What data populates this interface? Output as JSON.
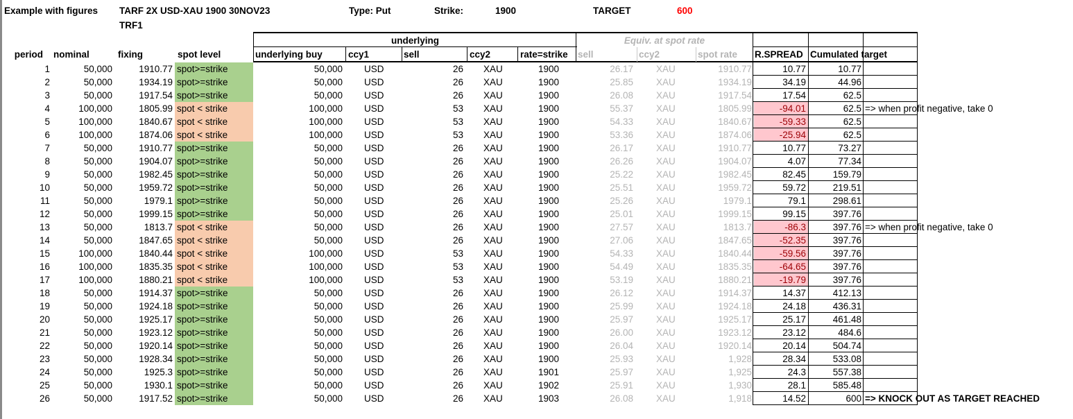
{
  "header": {
    "example_label": "Example with figures",
    "product": "TARF 2X USD-XAU 1900 30NOV23",
    "product_code": "TRF1",
    "type_label": "Type: Put",
    "strike_label": "Strike:",
    "strike_value": "1900",
    "target_label": "TARGET",
    "target_value": "600"
  },
  "groups": {
    "underlying": "underlying",
    "equiv": "Equiv. at spot rate"
  },
  "columns": {
    "period": "period",
    "nominal": "nominal",
    "fixing": "fixing",
    "spot_level": "spot level",
    "underlying_buy": "underlying buy",
    "ccy1": "ccy1",
    "sell": "sell",
    "ccy2": "ccy2",
    "rate_strike": "rate=strike",
    "eq_sell": "sell",
    "eq_ccy2": "ccy2",
    "spot_rate": "spot rate",
    "r_spread": "R.SPREAD",
    "cum_target": "Cumulated target"
  },
  "colors": {
    "green": "#a9d08e",
    "orange": "#f8cbad",
    "pink": "#ffc7ce",
    "dark_red": "#9c0006"
  },
  "rows": [
    {
      "period": "1",
      "nominal": "50,000",
      "fixing": "1910.77",
      "spot": "spot>=strike",
      "buy": "50,000",
      "ccy1": "USD",
      "sell": "26",
      "ccy2": "XAU",
      "rate": "1900",
      "eq_sell": "26.17",
      "eq_ccy2": "XAU",
      "spot_rate": "1910.77",
      "spread": "10.77",
      "cum": "10.77",
      "note": ""
    },
    {
      "period": "2",
      "nominal": "50,000",
      "fixing": "1934.19",
      "spot": "spot>=strike",
      "buy": "50,000",
      "ccy1": "USD",
      "sell": "26",
      "ccy2": "XAU",
      "rate": "1900",
      "eq_sell": "25.85",
      "eq_ccy2": "XAU",
      "spot_rate": "1934.19",
      "spread": "34.19",
      "cum": "44.96",
      "note": ""
    },
    {
      "period": "3",
      "nominal": "50,000",
      "fixing": "1917.54",
      "spot": "spot>=strike",
      "buy": "50,000",
      "ccy1": "USD",
      "sell": "26",
      "ccy2": "XAU",
      "rate": "1900",
      "eq_sell": "26.08",
      "eq_ccy2": "XAU",
      "spot_rate": "1917.54",
      "spread": "17.54",
      "cum": "62.5",
      "note": ""
    },
    {
      "period": "4",
      "nominal": "100,000",
      "fixing": "1805.99",
      "spot": "spot < strike",
      "buy": "100,000",
      "ccy1": "USD",
      "sell": "53",
      "ccy2": "XAU",
      "rate": "1900",
      "eq_sell": "55.37",
      "eq_ccy2": "XAU",
      "spot_rate": "1805.99",
      "spread": "-94.01",
      "cum": "62.5",
      "note": "=> when profit negative, take 0"
    },
    {
      "period": "5",
      "nominal": "100,000",
      "fixing": "1840.67",
      "spot": "spot < strike",
      "buy": "100,000",
      "ccy1": "USD",
      "sell": "53",
      "ccy2": "XAU",
      "rate": "1900",
      "eq_sell": "54.33",
      "eq_ccy2": "XAU",
      "spot_rate": "1840.67",
      "spread": "-59.33",
      "cum": "62.5",
      "note": ""
    },
    {
      "period": "6",
      "nominal": "100,000",
      "fixing": "1874.06",
      "spot": "spot < strike",
      "buy": "100,000",
      "ccy1": "USD",
      "sell": "53",
      "ccy2": "XAU",
      "rate": "1900",
      "eq_sell": "53.36",
      "eq_ccy2": "XAU",
      "spot_rate": "1874.06",
      "spread": "-25.94",
      "cum": "62.5",
      "note": ""
    },
    {
      "period": "7",
      "nominal": "50,000",
      "fixing": "1910.77",
      "spot": "spot>=strike",
      "buy": "50,000",
      "ccy1": "USD",
      "sell": "26",
      "ccy2": "XAU",
      "rate": "1900",
      "eq_sell": "26.17",
      "eq_ccy2": "XAU",
      "spot_rate": "1910.77",
      "spread": "10.77",
      "cum": "73.27",
      "note": ""
    },
    {
      "period": "8",
      "nominal": "50,000",
      "fixing": "1904.07",
      "spot": "spot>=strike",
      "buy": "50,000",
      "ccy1": "USD",
      "sell": "26",
      "ccy2": "XAU",
      "rate": "1900",
      "eq_sell": "26.26",
      "eq_ccy2": "XAU",
      "spot_rate": "1904.07",
      "spread": "4.07",
      "cum": "77.34",
      "note": ""
    },
    {
      "period": "9",
      "nominal": "50,000",
      "fixing": "1982.45",
      "spot": "spot>=strike",
      "buy": "50,000",
      "ccy1": "USD",
      "sell": "26",
      "ccy2": "XAU",
      "rate": "1900",
      "eq_sell": "25.22",
      "eq_ccy2": "XAU",
      "spot_rate": "1982.45",
      "spread": "82.45",
      "cum": "159.79",
      "note": ""
    },
    {
      "period": "10",
      "nominal": "50,000",
      "fixing": "1959.72",
      "spot": "spot>=strike",
      "buy": "50,000",
      "ccy1": "USD",
      "sell": "26",
      "ccy2": "XAU",
      "rate": "1900",
      "eq_sell": "25.51",
      "eq_ccy2": "XAU",
      "spot_rate": "1959.72",
      "spread": "59.72",
      "cum": "219.51",
      "note": ""
    },
    {
      "period": "11",
      "nominal": "50,000",
      "fixing": "1979.1",
      "spot": "spot>=strike",
      "buy": "50,000",
      "ccy1": "USD",
      "sell": "26",
      "ccy2": "XAU",
      "rate": "1900",
      "eq_sell": "25.26",
      "eq_ccy2": "XAU",
      "spot_rate": "1979.1",
      "spread": "79.1",
      "cum": "298.61",
      "note": ""
    },
    {
      "period": "12",
      "nominal": "50,000",
      "fixing": "1999.15",
      "spot": "spot>=strike",
      "buy": "50,000",
      "ccy1": "USD",
      "sell": "26",
      "ccy2": "XAU",
      "rate": "1900",
      "eq_sell": "25.01",
      "eq_ccy2": "XAU",
      "spot_rate": "1999.15",
      "spread": "99.15",
      "cum": "397.76",
      "note": ""
    },
    {
      "period": "13",
      "nominal": "50,000",
      "fixing": "1813.7",
      "spot": "spot < strike",
      "buy": "50,000",
      "ccy1": "USD",
      "sell": "26",
      "ccy2": "XAU",
      "rate": "1900",
      "eq_sell": "27.57",
      "eq_ccy2": "XAU",
      "spot_rate": "1813.7",
      "spread": "-86.3",
      "cum": "397.76",
      "note": "=> when profit negative, take 0"
    },
    {
      "period": "14",
      "nominal": "50,000",
      "fixing": "1847.65",
      "spot": "spot < strike",
      "buy": "50,000",
      "ccy1": "USD",
      "sell": "26",
      "ccy2": "XAU",
      "rate": "1900",
      "eq_sell": "27.06",
      "eq_ccy2": "XAU",
      "spot_rate": "1847.65",
      "spread": "-52.35",
      "cum": "397.76",
      "note": ""
    },
    {
      "period": "15",
      "nominal": "100,000",
      "fixing": "1840.44",
      "spot": "spot < strike",
      "buy": "100,000",
      "ccy1": "USD",
      "sell": "53",
      "ccy2": "XAU",
      "rate": "1900",
      "eq_sell": "54.33",
      "eq_ccy2": "XAU",
      "spot_rate": "1840.44",
      "spread": "-59.56",
      "cum": "397.76",
      "note": ""
    },
    {
      "period": "16",
      "nominal": "100,000",
      "fixing": "1835.35",
      "spot": "spot < strike",
      "buy": "100,000",
      "ccy1": "USD",
      "sell": "53",
      "ccy2": "XAU",
      "rate": "1900",
      "eq_sell": "54.49",
      "eq_ccy2": "XAU",
      "spot_rate": "1835.35",
      "spread": "-64.65",
      "cum": "397.76",
      "note": ""
    },
    {
      "period": "17",
      "nominal": "100,000",
      "fixing": "1880.21",
      "spot": "spot < strike",
      "buy": "100,000",
      "ccy1": "USD",
      "sell": "53",
      "ccy2": "XAU",
      "rate": "1900",
      "eq_sell": "53.19",
      "eq_ccy2": "XAU",
      "spot_rate": "1880.21",
      "spread": "-19.79",
      "cum": "397.76",
      "note": ""
    },
    {
      "period": "18",
      "nominal": "50,000",
      "fixing": "1914.37",
      "spot": "spot>=strike",
      "buy": "50,000",
      "ccy1": "USD",
      "sell": "26",
      "ccy2": "XAU",
      "rate": "1900",
      "eq_sell": "26.12",
      "eq_ccy2": "XAU",
      "spot_rate": "1914.37",
      "spread": "14.37",
      "cum": "412.13",
      "note": ""
    },
    {
      "period": "19",
      "nominal": "50,000",
      "fixing": "1924.18",
      "spot": "spot>=strike",
      "buy": "50,000",
      "ccy1": "USD",
      "sell": "26",
      "ccy2": "XAU",
      "rate": "1900",
      "eq_sell": "25.99",
      "eq_ccy2": "XAU",
      "spot_rate": "1924.18",
      "spread": "24.18",
      "cum": "436.31",
      "note": ""
    },
    {
      "period": "20",
      "nominal": "50,000",
      "fixing": "1925.17",
      "spot": "spot>=strike",
      "buy": "50,000",
      "ccy1": "USD",
      "sell": "26",
      "ccy2": "XAU",
      "rate": "1900",
      "eq_sell": "25.97",
      "eq_ccy2": "XAU",
      "spot_rate": "1925.17",
      "spread": "25.17",
      "cum": "461.48",
      "note": ""
    },
    {
      "period": "21",
      "nominal": "50,000",
      "fixing": "1923.12",
      "spot": "spot>=strike",
      "buy": "50,000",
      "ccy1": "USD",
      "sell": "26",
      "ccy2": "XAU",
      "rate": "1900",
      "eq_sell": "26.00",
      "eq_ccy2": "XAU",
      "spot_rate": "1923.12",
      "spread": "23.12",
      "cum": "484.6",
      "note": ""
    },
    {
      "period": "22",
      "nominal": "50,000",
      "fixing": "1920.14",
      "spot": "spot>=strike",
      "buy": "50,000",
      "ccy1": "USD",
      "sell": "26",
      "ccy2": "XAU",
      "rate": "1900",
      "eq_sell": "26.04",
      "eq_ccy2": "XAU",
      "spot_rate": "1920.14",
      "spread": "20.14",
      "cum": "504.74",
      "note": ""
    },
    {
      "period": "23",
      "nominal": "50,000",
      "fixing": "1928.34",
      "spot": "spot>=strike",
      "buy": "50,000",
      "ccy1": "USD",
      "sell": "26",
      "ccy2": "XAU",
      "rate": "1900",
      "eq_sell": "25.93",
      "eq_ccy2": "XAU",
      "spot_rate": "1,928",
      "spread": "28.34",
      "cum": "533.08",
      "note": ""
    },
    {
      "period": "24",
      "nominal": "50,000",
      "fixing": "1925.3",
      "spot": "spot>=strike",
      "buy": "50,000",
      "ccy1": "USD",
      "sell": "26",
      "ccy2": "XAU",
      "rate": "1901",
      "eq_sell": "25.97",
      "eq_ccy2": "XAU",
      "spot_rate": "1,925",
      "spread": "24.3",
      "cum": "557.38",
      "note": ""
    },
    {
      "period": "25",
      "nominal": "50,000",
      "fixing": "1930.1",
      "spot": "spot>=strike",
      "buy": "50,000",
      "ccy1": "USD",
      "sell": "26",
      "ccy2": "XAU",
      "rate": "1902",
      "eq_sell": "25.91",
      "eq_ccy2": "XAU",
      "spot_rate": "1,930",
      "spread": "28.1",
      "cum": "585.48",
      "note": ""
    },
    {
      "period": "26",
      "nominal": "50,000",
      "fixing": "1917.52",
      "spot": "spot>=strike",
      "buy": "50,000",
      "ccy1": "USD",
      "sell": "26",
      "ccy2": "XAU",
      "rate": "1903",
      "eq_sell": "26.08",
      "eq_ccy2": "XAU",
      "spot_rate": "1,918",
      "spread": "14.52",
      "cum": "600",
      "note": "=> KNOCK OUT AS TARGET REACHED"
    }
  ]
}
